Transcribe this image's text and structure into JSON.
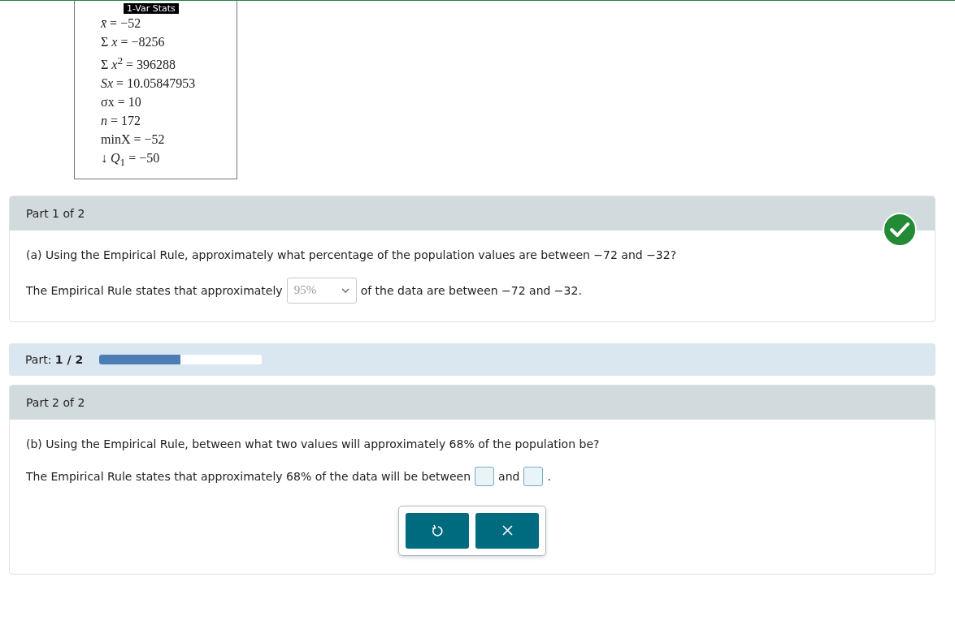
{
  "stats_box": {
    "title": "1-Var Stats",
    "lines": [
      "*x̄* = −52",
      "Σ *x* = −8256",
      "Σ *x*$^{2}$ = 396288",
      "*Sx* = 10.05847953",
      "σx = 10",
      "*n* = 172",
      "minX = −52",
      "↓ *Q*$_{1}$ = −50"
    ]
  },
  "parts": [
    {
      "kind": "answered",
      "header": "Part 1 of 2",
      "correct": true,
      "question": "(a) Using the Empirical Rule, approximately what percentage of the population values are between −72 and −32?",
      "answer_before": "The Empirical Rule states that approximately",
      "dropdown": {
        "value": "95%"
      },
      "answer_after": "of the data are between −72 and −32."
    },
    {
      "kind": "progress",
      "label": "Part: **1 / 2**",
      "level": 0.5
    },
    {
      "kind": "open",
      "header": "Part 2 of 2",
      "correct": false,
      "question": "(b) Using the Empirical Rule, between what two values will approximately 68% of the population be?",
      "answer_before": "The Empirical Rule states that approximately 68% of the data will be between",
      "answer_middle": "and",
      "answer_after": ".",
      "buttons": [
        {
          "kind": "reset"
        },
        {
          "kind": "clear"
        }
      ]
    }
  ]
}
